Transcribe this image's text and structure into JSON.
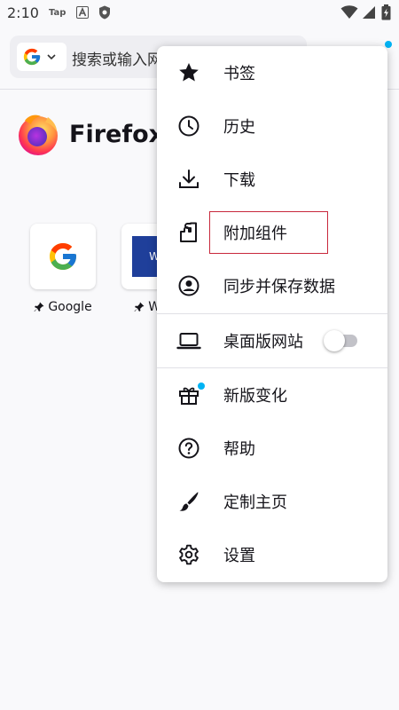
{
  "status_bar": {
    "time": "2:10",
    "app_tag": "Tap",
    "icons": [
      "tap-icon",
      "android-a-icon",
      "shield-icon",
      "wifi-icon",
      "signal-icon",
      "battery-icon"
    ]
  },
  "toolbar": {
    "search_engine": "Google",
    "url_placeholder": "搜索或输入网址"
  },
  "home": {
    "brand_name": "Firefox",
    "shortcuts": [
      {
        "label": "Google",
        "icon": "google-g-icon"
      },
      {
        "label": "Wiki",
        "icon": "wikipedia-icon"
      }
    ]
  },
  "menu": {
    "items": [
      {
        "label": "书签",
        "icon": "bookmark-star-icon"
      },
      {
        "label": "历史",
        "icon": "clock-icon"
      },
      {
        "label": "下载",
        "icon": "download-icon"
      },
      {
        "label": "附加组件",
        "icon": "puzzle-icon"
      },
      {
        "label": "同步并保存数据",
        "icon": "account-icon"
      },
      {
        "label": "桌面版网站",
        "icon": "laptop-icon"
      },
      {
        "label": "新版变化",
        "icon": "gift-icon"
      },
      {
        "label": "帮助",
        "icon": "help-icon"
      },
      {
        "label": "定制主页",
        "icon": "brush-icon"
      },
      {
        "label": "设置",
        "icon": "gear-icon"
      }
    ],
    "desktop_site_enabled": false,
    "highlighted_item": "附加组件"
  },
  "colors": {
    "accent_dot": "#00b3f4",
    "highlight_border": "#c8283c",
    "menu_background": "#ffffff",
    "page_background": "#f9f9fb"
  }
}
